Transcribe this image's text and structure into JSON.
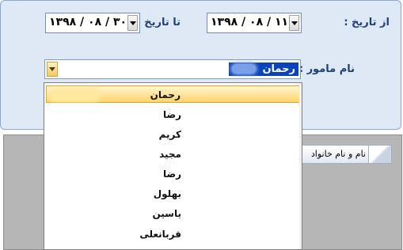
{
  "filters": {
    "from_label": "از تاریخ :",
    "from_date": "۱۳۹۸ / ۰۸ / ۱۱",
    "to_label": "تا تاریخ :",
    "to_date": "۱۳۹۸ / ۰۸ / ۳۰",
    "officer_label": "نام مامور :",
    "officer_selected": "رحمان"
  },
  "officer_dropdown": {
    "items": [
      "رحمان",
      "رضا",
      "کریم",
      "مجید",
      "رضا",
      "بهلول",
      "یاسین",
      "قربانعلی"
    ],
    "highlighted_index": 0
  },
  "grid": {
    "column_header": "نام و نام خانواد"
  },
  "colors": {
    "panel_bg": "#dfe9f5",
    "label_text": "#1e3f7a",
    "selection_bg": "#0b44b8",
    "highlight": "#ffd56b",
    "grid_bg": "#b6b6b6"
  }
}
